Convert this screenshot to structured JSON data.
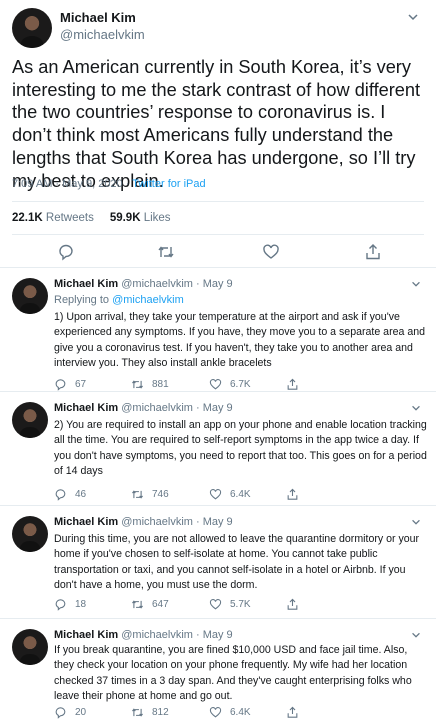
{
  "main_tweet": {
    "author_name": "Michael Kim",
    "author_handle": "@michaelvkim",
    "text": "As an American currently in South Korea, it’s very interesting to me the stark contrast of how different the two countries’ response to coronavirus is. I don’t think most Americans fully understand the lengths that South Korea has undergone, so I’ll try my best to explain.",
    "timestamp": "7:09 AM · May 9, 2020 · ",
    "source": "Twitter for iPad",
    "retweets_count": "22.1K",
    "retweets_label": "Retweets",
    "likes_count": "59.9K",
    "likes_label": "Likes"
  },
  "replies": [
    {
      "author_name": "Michael Kim",
      "author_handle": "@michaelvkim · May 9",
      "replying_prefix": "Replying to ",
      "replying_handle": "@michaelvkim",
      "text": "1) Upon arrival, they take your temperature at the airport and ask if you've experienced any symptoms. If you have, they move you to a separate area and give you a coronavirus test. If you haven't, they take you to another area and interview you. They also install ankle bracelets",
      "replies_count": "67",
      "retweets_count": "881",
      "likes_count": "6.7K"
    },
    {
      "author_name": "Michael Kim",
      "author_handle": "@michaelvkim · May 9",
      "text": "2) You are required to install an app on your phone and enable location tracking all the time. You are required to self-report symptoms in the app twice a day. If you don't have symptoms, you need to report that too. This goes on for a period of 14 days",
      "replies_count": "46",
      "retweets_count": "746",
      "likes_count": "6.4K"
    },
    {
      "author_name": "Michael Kim",
      "author_handle": "@michaelvkim · May 9",
      "text": "During this time, you are not allowed to leave the quarantine dormitory or your home if you've chosen to self-isolate at home. You cannot take public transportation or taxi, and you cannot self-isolate in a hotel or Airbnb. If you don't have a home, you must use the dorm.",
      "replies_count": "18",
      "retweets_count": "647",
      "likes_count": "5.7K"
    },
    {
      "author_name": "Michael Kim",
      "author_handle": "@michaelvkim · May 9",
      "text": "If you break quarantine, you are fined $10,000 USD and face jail time. Also, they check your location on your phone frequently. My wife had her location checked 37 times in a 3 day span. And they've caught enterprising folks who leave their phone at home and go out.",
      "replies_count": "20",
      "retweets_count": "812",
      "likes_count": "6.4K"
    }
  ],
  "icons": [
    "chevron-down-icon",
    "reply-icon",
    "retweet-icon",
    "like-icon",
    "share-icon"
  ],
  "colors": {
    "accent": "#1da1f2",
    "secondary_text": "#657786",
    "divider": "#e6ecf0"
  }
}
